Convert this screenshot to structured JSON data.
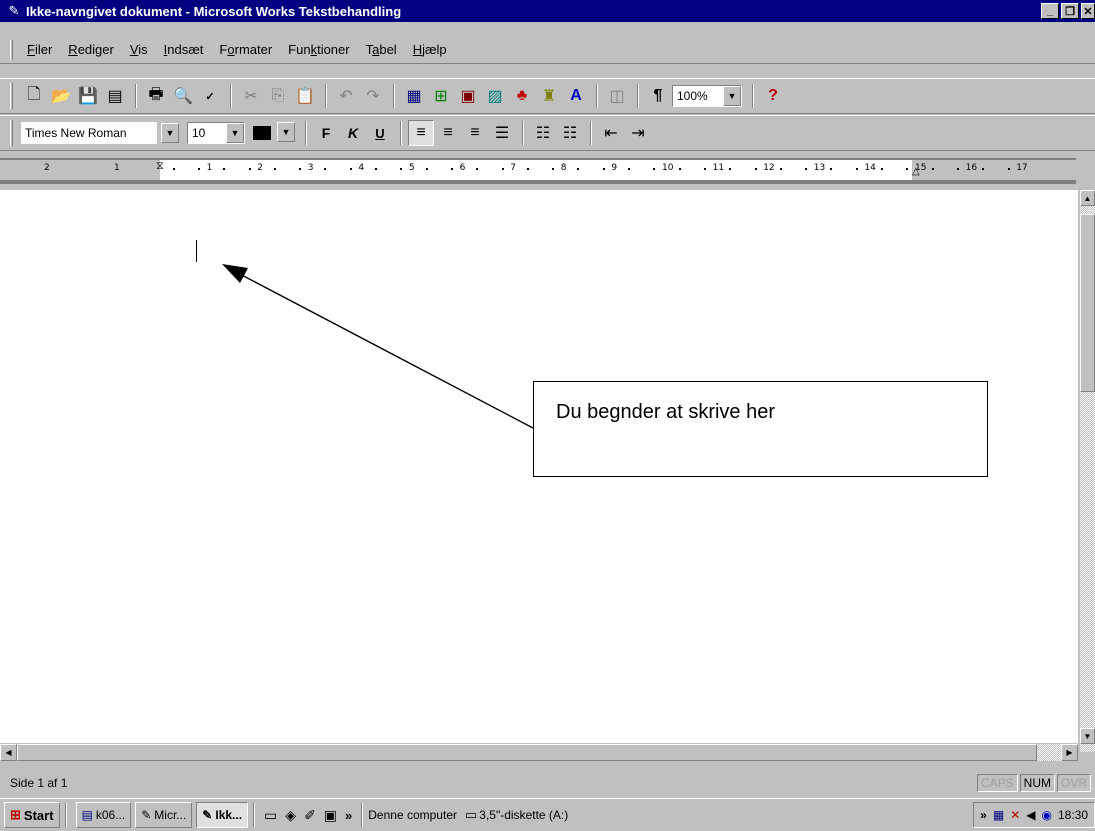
{
  "window": {
    "title": "Ikke-navngivet dokument - Microsoft Works Tekstbehandling"
  },
  "menu": {
    "items": [
      {
        "label": "Filer",
        "accel": "F"
      },
      {
        "label": "Rediger",
        "accel": "R"
      },
      {
        "label": "Vis",
        "accel": "V"
      },
      {
        "label": "Indsæt",
        "accel": "I"
      },
      {
        "label": "Formater",
        "accel": "o"
      },
      {
        "label": "Funktioner",
        "accel": "k"
      },
      {
        "label": "Tabel",
        "accel": "a"
      },
      {
        "label": "Hjælp",
        "accel": "H"
      }
    ]
  },
  "toolbar": {
    "zoom": "100%"
  },
  "format": {
    "font": "Times New Roman",
    "size": "10",
    "bold": "F",
    "italic": "K",
    "underline": "U"
  },
  "ruler": {
    "left_labels": [
      "2",
      "1"
    ],
    "labels": [
      "1",
      "2",
      "3",
      "4",
      "5",
      "6",
      "7",
      "8",
      "9",
      "10",
      "11",
      "12",
      "13",
      "14",
      "15",
      "16",
      "17"
    ]
  },
  "document": {
    "callout_text": "Du begnder at skrive her"
  },
  "status": {
    "page": "Side 1 af 1",
    "caps": "CAPS",
    "num": "NUM",
    "ovr": "OVR"
  },
  "taskbar": {
    "start": "Start",
    "tasks": [
      "k06...",
      "Micr...",
      "Ikk..."
    ],
    "more": "»",
    "computer": "Denne computer",
    "drive": "3,5\"-diskette (A:)",
    "tray_more": "»",
    "time": "18:30"
  }
}
